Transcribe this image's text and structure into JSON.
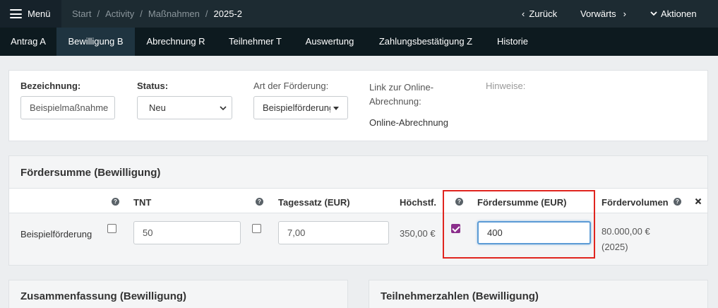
{
  "topbar": {
    "menu_label": "Menü",
    "breadcrumb": [
      "Start",
      "Activity",
      "Maßnahmen",
      "2025-2"
    ],
    "back_label": "Zurück",
    "forward_label": "Vorwärts",
    "actions_label": "Aktionen"
  },
  "tabs": [
    "Antrag A",
    "Bewilligung B",
    "Abrechnung R",
    "Teilnehmer T",
    "Auswertung",
    "Zahlungsbestätigung Z",
    "Historie"
  ],
  "active_tab": "Bewilligung B",
  "info": {
    "bezeichnung_label": "Bezeichnung:",
    "bezeichnung_value": "Beispielmaßnahme",
    "status_label": "Status:",
    "status_value": "Neu",
    "art_label": "Art der Förderung:",
    "art_value": "Beispielförderung",
    "link_label": "Link zur Online-Abrechnung:",
    "link_text": "Online-Abrechnung",
    "hinweise_label": "Hinweise:"
  },
  "foerdersumme": {
    "title": "Fördersumme (Bewilligung)",
    "headers": {
      "tnt": "TNT",
      "tagessatz": "Tagessatz (EUR)",
      "hoechst": "Höchstf.",
      "foerdersumme": "Fördersumme (EUR)",
      "foerdervolumen": "Fördervolumen"
    },
    "row": {
      "name": "Beispielförderung",
      "tnt_value": "50",
      "tagessatz_value": "7,00",
      "hoechst_value": "350,00 €",
      "foerdersumme_value": "400",
      "foerdervolumen_value": "80.000,00 €",
      "foerdervolumen_year": "(2025)",
      "tnt_checked": false,
      "tagessatz_checked": false,
      "foerdersumme_checked": true
    }
  },
  "summary_title": "Zusammenfassung (Bewilligung)",
  "teilnehmer_title": "Teilnehmerzahlen (Bewilligung)",
  "colors": {
    "navbar": "#1d2b32",
    "tabbar": "#0d1a1f",
    "accent_checkbox": "#8b2f8c",
    "highlight": "#e0251f",
    "focus_border": "#5b9bd5"
  }
}
